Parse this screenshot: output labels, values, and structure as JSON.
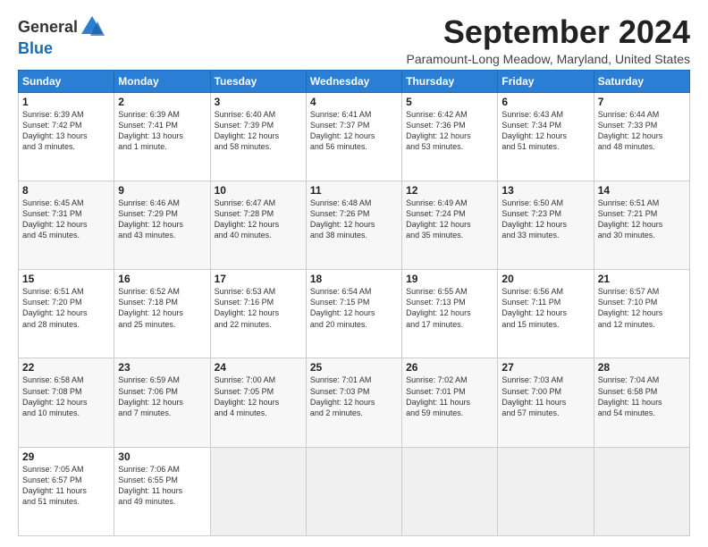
{
  "header": {
    "logo_general": "General",
    "logo_blue": "Blue",
    "month_title": "September 2024",
    "location": "Paramount-Long Meadow, Maryland, United States"
  },
  "days_of_week": [
    "Sunday",
    "Monday",
    "Tuesday",
    "Wednesday",
    "Thursday",
    "Friday",
    "Saturday"
  ],
  "weeks": [
    [
      {
        "day": "1",
        "info": "Sunrise: 6:39 AM\nSunset: 7:42 PM\nDaylight: 13 hours\nand 3 minutes."
      },
      {
        "day": "2",
        "info": "Sunrise: 6:39 AM\nSunset: 7:41 PM\nDaylight: 13 hours\nand 1 minute."
      },
      {
        "day": "3",
        "info": "Sunrise: 6:40 AM\nSunset: 7:39 PM\nDaylight: 12 hours\nand 58 minutes."
      },
      {
        "day": "4",
        "info": "Sunrise: 6:41 AM\nSunset: 7:37 PM\nDaylight: 12 hours\nand 56 minutes."
      },
      {
        "day": "5",
        "info": "Sunrise: 6:42 AM\nSunset: 7:36 PM\nDaylight: 12 hours\nand 53 minutes."
      },
      {
        "day": "6",
        "info": "Sunrise: 6:43 AM\nSunset: 7:34 PM\nDaylight: 12 hours\nand 51 minutes."
      },
      {
        "day": "7",
        "info": "Sunrise: 6:44 AM\nSunset: 7:33 PM\nDaylight: 12 hours\nand 48 minutes."
      }
    ],
    [
      {
        "day": "8",
        "info": "Sunrise: 6:45 AM\nSunset: 7:31 PM\nDaylight: 12 hours\nand 45 minutes."
      },
      {
        "day": "9",
        "info": "Sunrise: 6:46 AM\nSunset: 7:29 PM\nDaylight: 12 hours\nand 43 minutes."
      },
      {
        "day": "10",
        "info": "Sunrise: 6:47 AM\nSunset: 7:28 PM\nDaylight: 12 hours\nand 40 minutes."
      },
      {
        "day": "11",
        "info": "Sunrise: 6:48 AM\nSunset: 7:26 PM\nDaylight: 12 hours\nand 38 minutes."
      },
      {
        "day": "12",
        "info": "Sunrise: 6:49 AM\nSunset: 7:24 PM\nDaylight: 12 hours\nand 35 minutes."
      },
      {
        "day": "13",
        "info": "Sunrise: 6:50 AM\nSunset: 7:23 PM\nDaylight: 12 hours\nand 33 minutes."
      },
      {
        "day": "14",
        "info": "Sunrise: 6:51 AM\nSunset: 7:21 PM\nDaylight: 12 hours\nand 30 minutes."
      }
    ],
    [
      {
        "day": "15",
        "info": "Sunrise: 6:51 AM\nSunset: 7:20 PM\nDaylight: 12 hours\nand 28 minutes."
      },
      {
        "day": "16",
        "info": "Sunrise: 6:52 AM\nSunset: 7:18 PM\nDaylight: 12 hours\nand 25 minutes."
      },
      {
        "day": "17",
        "info": "Sunrise: 6:53 AM\nSunset: 7:16 PM\nDaylight: 12 hours\nand 22 minutes."
      },
      {
        "day": "18",
        "info": "Sunrise: 6:54 AM\nSunset: 7:15 PM\nDaylight: 12 hours\nand 20 minutes."
      },
      {
        "day": "19",
        "info": "Sunrise: 6:55 AM\nSunset: 7:13 PM\nDaylight: 12 hours\nand 17 minutes."
      },
      {
        "day": "20",
        "info": "Sunrise: 6:56 AM\nSunset: 7:11 PM\nDaylight: 12 hours\nand 15 minutes."
      },
      {
        "day": "21",
        "info": "Sunrise: 6:57 AM\nSunset: 7:10 PM\nDaylight: 12 hours\nand 12 minutes."
      }
    ],
    [
      {
        "day": "22",
        "info": "Sunrise: 6:58 AM\nSunset: 7:08 PM\nDaylight: 12 hours\nand 10 minutes."
      },
      {
        "day": "23",
        "info": "Sunrise: 6:59 AM\nSunset: 7:06 PM\nDaylight: 12 hours\nand 7 minutes."
      },
      {
        "day": "24",
        "info": "Sunrise: 7:00 AM\nSunset: 7:05 PM\nDaylight: 12 hours\nand 4 minutes."
      },
      {
        "day": "25",
        "info": "Sunrise: 7:01 AM\nSunset: 7:03 PM\nDaylight: 12 hours\nand 2 minutes."
      },
      {
        "day": "26",
        "info": "Sunrise: 7:02 AM\nSunset: 7:01 PM\nDaylight: 11 hours\nand 59 minutes."
      },
      {
        "day": "27",
        "info": "Sunrise: 7:03 AM\nSunset: 7:00 PM\nDaylight: 11 hours\nand 57 minutes."
      },
      {
        "day": "28",
        "info": "Sunrise: 7:04 AM\nSunset: 6:58 PM\nDaylight: 11 hours\nand 54 minutes."
      }
    ],
    [
      {
        "day": "29",
        "info": "Sunrise: 7:05 AM\nSunset: 6:57 PM\nDaylight: 11 hours\nand 51 minutes."
      },
      {
        "day": "30",
        "info": "Sunrise: 7:06 AM\nSunset: 6:55 PM\nDaylight: 11 hours\nand 49 minutes."
      },
      {
        "day": "",
        "info": ""
      },
      {
        "day": "",
        "info": ""
      },
      {
        "day": "",
        "info": ""
      },
      {
        "day": "",
        "info": ""
      },
      {
        "day": "",
        "info": ""
      }
    ]
  ]
}
